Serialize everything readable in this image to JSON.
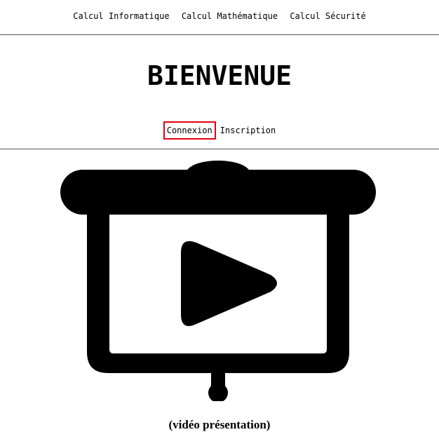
{
  "top_nav": {
    "items": [
      {
        "label": "Calcul Informatique"
      },
      {
        "label": "Calcul Mathématique"
      },
      {
        "label": "Calcul Sécurité"
      }
    ]
  },
  "header": {
    "title": "BIENVENUE"
  },
  "auth_nav": {
    "login_label": "Connexion",
    "signup_label": "Inscription"
  },
  "main": {
    "video_icon": "projector-screen-play-icon",
    "caption": "(vidéo présentation)"
  },
  "colors": {
    "highlight_border": "#e3000f",
    "text": "#000000",
    "divider": "#555555"
  }
}
